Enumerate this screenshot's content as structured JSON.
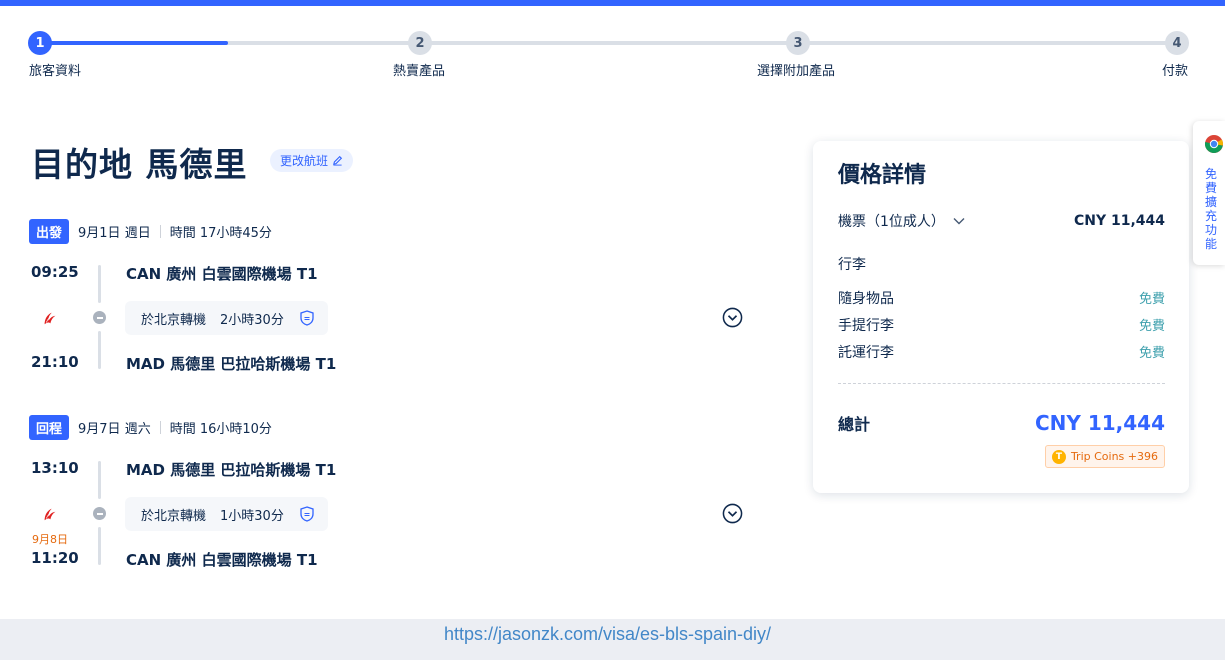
{
  "stepper": {
    "steps": [
      {
        "num": "1",
        "label": "旅客資料"
      },
      {
        "num": "2",
        "label": "熱賣產品"
      },
      {
        "num": "3",
        "label": "選擇附加產品"
      },
      {
        "num": "4",
        "label": "付款"
      }
    ],
    "current_step": 1
  },
  "header": {
    "title": "目的地 馬德里",
    "change_flight": "更改航班"
  },
  "outbound": {
    "tag": "出發",
    "date": "9月1日 週日",
    "duration": "時間 17小時45分",
    "depart_time": "09:25",
    "depart_airport": "CAN 廣州 白雲國際機場 T1",
    "transfer_label": "於北京轉機",
    "transfer_duration": "2小時30分",
    "arrive_time": "21:10",
    "arrive_airport": "MAD 馬德里 巴拉哈斯機場 T1"
  },
  "return": {
    "tag": "回程",
    "date": "9月7日 週六",
    "duration": "時間 16小時10分",
    "depart_time": "13:10",
    "depart_airport": "MAD 馬德里 巴拉哈斯機場 T1",
    "transfer_label": "於北京轉機",
    "transfer_duration": "1小時30分",
    "arrive_date_note": "9月8日",
    "arrive_time": "11:20",
    "arrive_airport": "CAN 廣州 白雲國際機場 T1"
  },
  "price": {
    "title": "價格詳情",
    "fare_label": "機票（1位成人）",
    "fare_value": "CNY 11,444",
    "baggage_title": "行李",
    "baggage": [
      {
        "label": "隨身物品",
        "value": "免費"
      },
      {
        "label": "手提行李",
        "value": "免費"
      },
      {
        "label": "託運行李",
        "value": "免費"
      }
    ],
    "total_label": "總計",
    "total_value": "CNY 11,444",
    "trip_coins": "Trip Coins +396"
  },
  "extension": {
    "label": "免費擴充功能"
  },
  "footer": {
    "url": "https://jasonzk.com/visa/es-bls-spain-diy/"
  },
  "colors": {
    "accent": "#3264ff",
    "free": "#3ea0ad",
    "orange": "#e56a0f"
  }
}
